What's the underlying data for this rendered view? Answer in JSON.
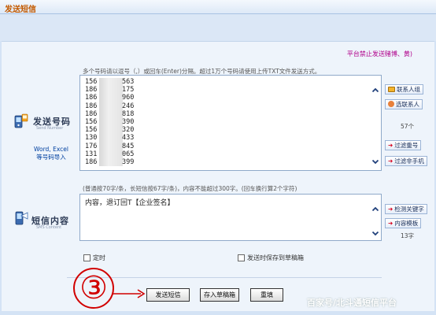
{
  "window": {
    "title": "发送短信"
  },
  "notice": "平台禁止发送赌博、黄)",
  "recipients": {
    "hint": "多个号码请以逗号（,）或回车(Enter)分隔。超过1万个号码请使用上传TXT文件发送方式。",
    "section_label": "发送号码",
    "section_sub": "Send Number",
    "import_note": "Word, Excel\n等号码导入",
    "numbers": [
      {
        "prefix": "156",
        "suffix": "563"
      },
      {
        "prefix": "186",
        "suffix": "175"
      },
      {
        "prefix": "186",
        "suffix": "960"
      },
      {
        "prefix": "186",
        "suffix": "246"
      },
      {
        "prefix": "186",
        "suffix": "818"
      },
      {
        "prefix": "156",
        "suffix": "390"
      },
      {
        "prefix": "156",
        "suffix": "320"
      },
      {
        "prefix": "130",
        "suffix": "433"
      },
      {
        "prefix": "176",
        "suffix": "845"
      },
      {
        "prefix": "131",
        "suffix": "065"
      },
      {
        "prefix": "186",
        "suffix": "399"
      }
    ],
    "buttons": {
      "contact_group": "联系人组",
      "select_contact": "选联系人",
      "filter_duplicates": "过滤重号",
      "filter_non_mobile": "过滤非手机"
    },
    "count": "57个"
  },
  "message": {
    "hint": "(普通按70字/条，长短信按67字/条)，内容不能超过300字。(回车换行算2个字符)",
    "section_label": "短信内容",
    "section_sub": "SMS Content",
    "content": "内容，退订回T【企业签名】",
    "buttons": {
      "check_keywords": "检测关键字",
      "content_template": "内容模板"
    },
    "count": "13字"
  },
  "options": {
    "scheduled": "定时",
    "save_draft_on_send": "发送时保存到草稿箱"
  },
  "actions": {
    "send": "发送短信",
    "save_draft": "存入草稿箱",
    "reset": "重填"
  },
  "annotation": {
    "step": "③"
  },
  "watermark": "百家号/北斗通短信平台",
  "colors": {
    "title": "#c35a00",
    "notice": "#b0008b",
    "link": "#0040a0",
    "annotation": "#d10000"
  }
}
